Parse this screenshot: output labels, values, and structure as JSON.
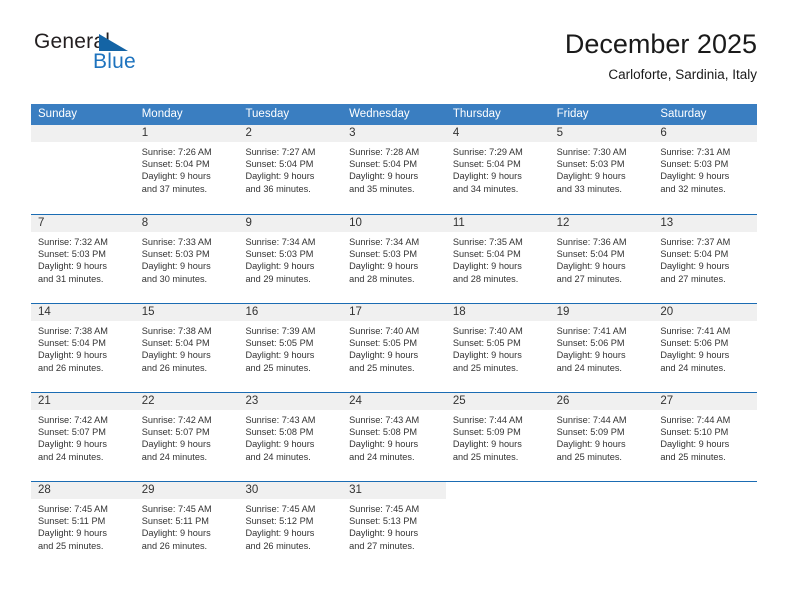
{
  "brand": {
    "word_one": "General",
    "word_two": "Blue",
    "accent_color": "#1464a5"
  },
  "header": {
    "month_title": "December 2025",
    "location": "Carloforte, Sardinia, Italy",
    "header_bg_color": "#3a7ec1",
    "divider_color": "#1b6cb3"
  },
  "weekdays": [
    "Sunday",
    "Monday",
    "Tuesday",
    "Wednesday",
    "Thursday",
    "Friday",
    "Saturday"
  ],
  "weeks": [
    [
      {
        "day": "",
        "sunrise": "",
        "sunset": "",
        "daylight_line1": "",
        "daylight_line2": "",
        "empty": true
      },
      {
        "day": "1",
        "sunrise": "Sunrise: 7:26 AM",
        "sunset": "Sunset: 5:04 PM",
        "daylight_line1": "Daylight: 9 hours",
        "daylight_line2": "and 37 minutes."
      },
      {
        "day": "2",
        "sunrise": "Sunrise: 7:27 AM",
        "sunset": "Sunset: 5:04 PM",
        "daylight_line1": "Daylight: 9 hours",
        "daylight_line2": "and 36 minutes."
      },
      {
        "day": "3",
        "sunrise": "Sunrise: 7:28 AM",
        "sunset": "Sunset: 5:04 PM",
        "daylight_line1": "Daylight: 9 hours",
        "daylight_line2": "and 35 minutes."
      },
      {
        "day": "4",
        "sunrise": "Sunrise: 7:29 AM",
        "sunset": "Sunset: 5:04 PM",
        "daylight_line1": "Daylight: 9 hours",
        "daylight_line2": "and 34 minutes."
      },
      {
        "day": "5",
        "sunrise": "Sunrise: 7:30 AM",
        "sunset": "Sunset: 5:03 PM",
        "daylight_line1": "Daylight: 9 hours",
        "daylight_line2": "and 33 minutes."
      },
      {
        "day": "6",
        "sunrise": "Sunrise: 7:31 AM",
        "sunset": "Sunset: 5:03 PM",
        "daylight_line1": "Daylight: 9 hours",
        "daylight_line2": "and 32 minutes."
      }
    ],
    [
      {
        "day": "7",
        "sunrise": "Sunrise: 7:32 AM",
        "sunset": "Sunset: 5:03 PM",
        "daylight_line1": "Daylight: 9 hours",
        "daylight_line2": "and 31 minutes."
      },
      {
        "day": "8",
        "sunrise": "Sunrise: 7:33 AM",
        "sunset": "Sunset: 5:03 PM",
        "daylight_line1": "Daylight: 9 hours",
        "daylight_line2": "and 30 minutes."
      },
      {
        "day": "9",
        "sunrise": "Sunrise: 7:34 AM",
        "sunset": "Sunset: 5:03 PM",
        "daylight_line1": "Daylight: 9 hours",
        "daylight_line2": "and 29 minutes."
      },
      {
        "day": "10",
        "sunrise": "Sunrise: 7:34 AM",
        "sunset": "Sunset: 5:03 PM",
        "daylight_line1": "Daylight: 9 hours",
        "daylight_line2": "and 28 minutes."
      },
      {
        "day": "11",
        "sunrise": "Sunrise: 7:35 AM",
        "sunset": "Sunset: 5:04 PM",
        "daylight_line1": "Daylight: 9 hours",
        "daylight_line2": "and 28 minutes."
      },
      {
        "day": "12",
        "sunrise": "Sunrise: 7:36 AM",
        "sunset": "Sunset: 5:04 PM",
        "daylight_line1": "Daylight: 9 hours",
        "daylight_line2": "and 27 minutes."
      },
      {
        "day": "13",
        "sunrise": "Sunrise: 7:37 AM",
        "sunset": "Sunset: 5:04 PM",
        "daylight_line1": "Daylight: 9 hours",
        "daylight_line2": "and 27 minutes."
      }
    ],
    [
      {
        "day": "14",
        "sunrise": "Sunrise: 7:38 AM",
        "sunset": "Sunset: 5:04 PM",
        "daylight_line1": "Daylight: 9 hours",
        "daylight_line2": "and 26 minutes."
      },
      {
        "day": "15",
        "sunrise": "Sunrise: 7:38 AM",
        "sunset": "Sunset: 5:04 PM",
        "daylight_line1": "Daylight: 9 hours",
        "daylight_line2": "and 26 minutes."
      },
      {
        "day": "16",
        "sunrise": "Sunrise: 7:39 AM",
        "sunset": "Sunset: 5:05 PM",
        "daylight_line1": "Daylight: 9 hours",
        "daylight_line2": "and 25 minutes."
      },
      {
        "day": "17",
        "sunrise": "Sunrise: 7:40 AM",
        "sunset": "Sunset: 5:05 PM",
        "daylight_line1": "Daylight: 9 hours",
        "daylight_line2": "and 25 minutes."
      },
      {
        "day": "18",
        "sunrise": "Sunrise: 7:40 AM",
        "sunset": "Sunset: 5:05 PM",
        "daylight_line1": "Daylight: 9 hours",
        "daylight_line2": "and 25 minutes."
      },
      {
        "day": "19",
        "sunrise": "Sunrise: 7:41 AM",
        "sunset": "Sunset: 5:06 PM",
        "daylight_line1": "Daylight: 9 hours",
        "daylight_line2": "and 24 minutes."
      },
      {
        "day": "20",
        "sunrise": "Sunrise: 7:41 AM",
        "sunset": "Sunset: 5:06 PM",
        "daylight_line1": "Daylight: 9 hours",
        "daylight_line2": "and 24 minutes."
      }
    ],
    [
      {
        "day": "21",
        "sunrise": "Sunrise: 7:42 AM",
        "sunset": "Sunset: 5:07 PM",
        "daylight_line1": "Daylight: 9 hours",
        "daylight_line2": "and 24 minutes."
      },
      {
        "day": "22",
        "sunrise": "Sunrise: 7:42 AM",
        "sunset": "Sunset: 5:07 PM",
        "daylight_line1": "Daylight: 9 hours",
        "daylight_line2": "and 24 minutes."
      },
      {
        "day": "23",
        "sunrise": "Sunrise: 7:43 AM",
        "sunset": "Sunset: 5:08 PM",
        "daylight_line1": "Daylight: 9 hours",
        "daylight_line2": "and 24 minutes."
      },
      {
        "day": "24",
        "sunrise": "Sunrise: 7:43 AM",
        "sunset": "Sunset: 5:08 PM",
        "daylight_line1": "Daylight: 9 hours",
        "daylight_line2": "and 24 minutes."
      },
      {
        "day": "25",
        "sunrise": "Sunrise: 7:44 AM",
        "sunset": "Sunset: 5:09 PM",
        "daylight_line1": "Daylight: 9 hours",
        "daylight_line2": "and 25 minutes."
      },
      {
        "day": "26",
        "sunrise": "Sunrise: 7:44 AM",
        "sunset": "Sunset: 5:09 PM",
        "daylight_line1": "Daylight: 9 hours",
        "daylight_line2": "and 25 minutes."
      },
      {
        "day": "27",
        "sunrise": "Sunrise: 7:44 AM",
        "sunset": "Sunset: 5:10 PM",
        "daylight_line1": "Daylight: 9 hours",
        "daylight_line2": "and 25 minutes."
      }
    ],
    [
      {
        "day": "28",
        "sunrise": "Sunrise: 7:45 AM",
        "sunset": "Sunset: 5:11 PM",
        "daylight_line1": "Daylight: 9 hours",
        "daylight_line2": "and 25 minutes."
      },
      {
        "day": "29",
        "sunrise": "Sunrise: 7:45 AM",
        "sunset": "Sunset: 5:11 PM",
        "daylight_line1": "Daylight: 9 hours",
        "daylight_line2": "and 26 minutes."
      },
      {
        "day": "30",
        "sunrise": "Sunrise: 7:45 AM",
        "sunset": "Sunset: 5:12 PM",
        "daylight_line1": "Daylight: 9 hours",
        "daylight_line2": "and 26 minutes."
      },
      {
        "day": "31",
        "sunrise": "Sunrise: 7:45 AM",
        "sunset": "Sunset: 5:13 PM",
        "daylight_line1": "Daylight: 9 hours",
        "daylight_line2": "and 27 minutes."
      },
      {
        "day": "",
        "sunrise": "",
        "sunset": "",
        "daylight_line1": "",
        "daylight_line2": "",
        "empty": true,
        "blank": true
      },
      {
        "day": "",
        "sunrise": "",
        "sunset": "",
        "daylight_line1": "",
        "daylight_line2": "",
        "empty": true,
        "blank": true
      },
      {
        "day": "",
        "sunrise": "",
        "sunset": "",
        "daylight_line1": "",
        "daylight_line2": "",
        "empty": true,
        "blank": true
      }
    ]
  ]
}
